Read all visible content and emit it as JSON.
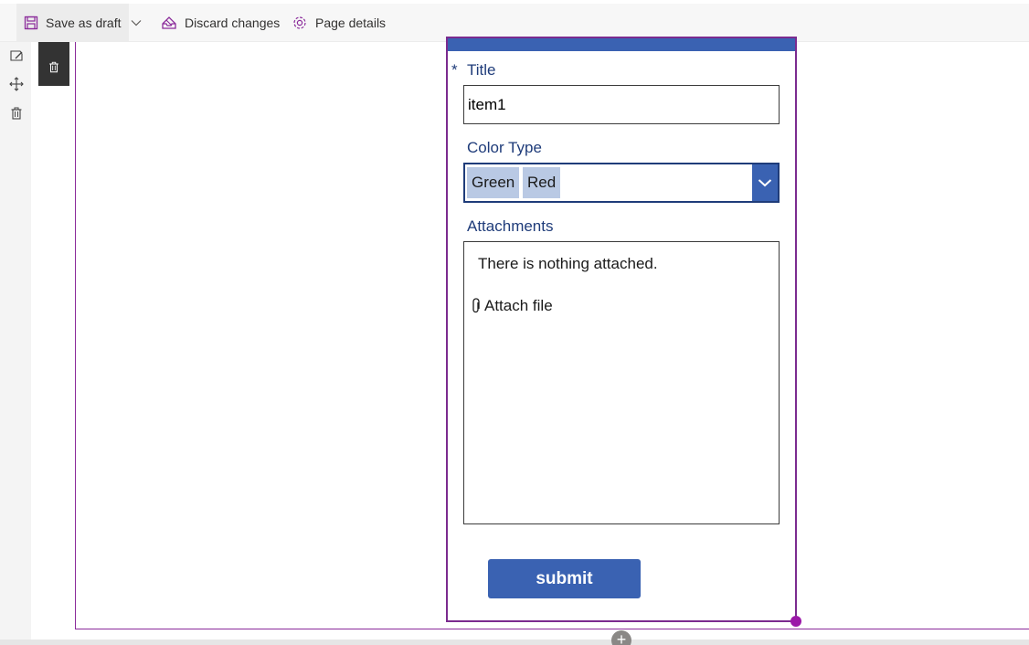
{
  "toolbar": {
    "save_label": "Save as draft",
    "discard_label": "Discard changes",
    "details_label": "Page details"
  },
  "form": {
    "title_required_marker": "*",
    "title_label": "Title",
    "title_value": "item1",
    "color_label": "Color Type",
    "color_selected": [
      "Green",
      "Red"
    ],
    "attachments_label": "Attachments",
    "attachments_empty_text": "There is nothing attached.",
    "attach_file_label": "Attach file",
    "submit_label": "submit"
  },
  "colors": {
    "accent_blue": "#3a62b2",
    "selection_purple": "#7b2b8f"
  },
  "icons": [
    "save-icon",
    "chevron-down-icon",
    "discard-icon",
    "gear-icon",
    "edit-icon",
    "move-icon",
    "trash-icon",
    "paperclip-icon",
    "add-icon"
  ]
}
